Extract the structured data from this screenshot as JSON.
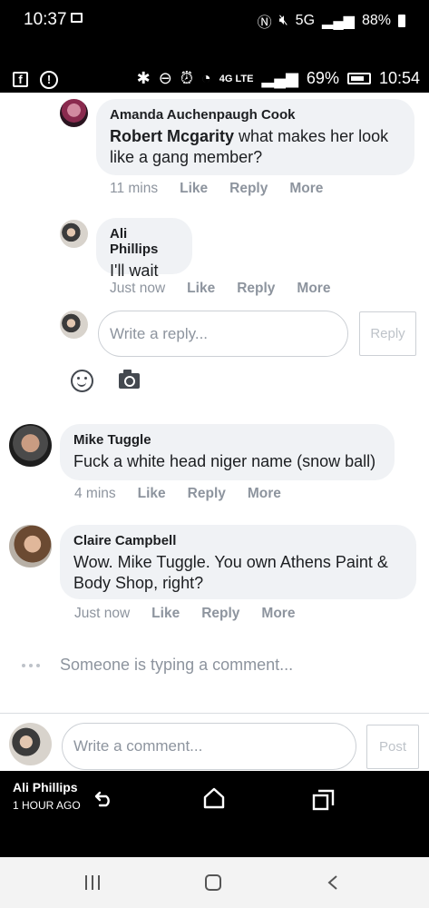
{
  "outer_status": {
    "time": "10:37",
    "network": "5G",
    "battery": "88%",
    "icons": [
      "gallery-icon",
      "nfc-icon",
      "mute-icon",
      "signal-icon",
      "battery-icon"
    ]
  },
  "inner_status": {
    "battery": "69%",
    "time": "10:54",
    "network": "4G LTE",
    "icons": [
      "facebook-icon",
      "alert-icon",
      "bluetooth-icon",
      "dnd-icon",
      "alarm-icon",
      "wifi-icon",
      "signal-icon",
      "battery-icon"
    ]
  },
  "replies": [
    {
      "author": "Amanda Auchenpaugh Cook",
      "mention": "Robert Mcgarity",
      "text": " what makes her look like a gang member?",
      "time": "11 mins",
      "like": "Like",
      "reply": "Reply",
      "more": "More"
    },
    {
      "author": "Ali Phillips",
      "text": "I'll wait",
      "time": "Just now",
      "like": "Like",
      "reply": "Reply",
      "more": "More"
    }
  ],
  "reply_box": {
    "placeholder": "Write a reply...",
    "button": "Reply"
  },
  "comments": [
    {
      "author": "Mike Tuggle",
      "text": "Fuck a white head niger name (snow ball)",
      "time": "4 mins",
      "like": "Like",
      "reply": "Reply",
      "more": "More"
    },
    {
      "author": "Claire Campbell",
      "text": "Wow. Mike Tuggle. You own Athens Paint & Body Shop, right?",
      "time": "Just now",
      "like": "Like",
      "reply": "Reply",
      "more": "More"
    }
  ],
  "typing_indicator": "Someone is typing a comment...",
  "composer": {
    "placeholder": "Write a comment...",
    "button": "Post"
  },
  "story_overlay": {
    "owner": "Ali Phillips",
    "time_ago": "1 HOUR AGO"
  }
}
